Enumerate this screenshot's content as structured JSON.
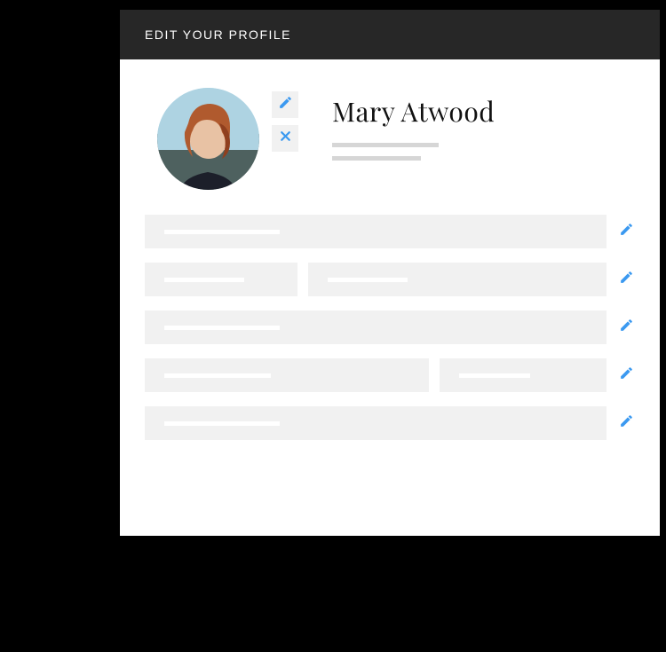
{
  "header": {
    "title": "EDIT YOUR PROFILE"
  },
  "profile": {
    "display_name": "Mary Atwood"
  },
  "icons": {
    "edit_avatar": "pencil-icon",
    "remove_avatar": "close-icon",
    "edit_row": "pencil-icon"
  },
  "colors": {
    "accent": "#3B99F0",
    "header_bg": "#272727",
    "field_bg": "#f1f1f1"
  }
}
